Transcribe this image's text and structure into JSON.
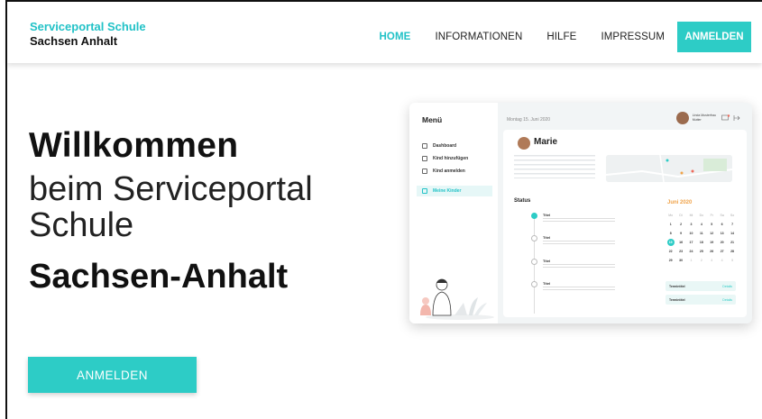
{
  "header": {
    "brand_top": "Serviceportal Schule",
    "brand_bottom": "Sachsen Anhalt",
    "nav": [
      "HOME",
      "INFORMATIONEN",
      "HILFE",
      "IMPRESSUM"
    ],
    "login": "ANMELDEN"
  },
  "hero": {
    "line1": "Willkommen",
    "line2": "beim Serviceportal",
    "line3": "Schule",
    "line4": "Sachsen-Anhalt",
    "button": "ANMELDEN"
  },
  "mockup": {
    "menu_title": "Menü",
    "menu_items": [
      "Dashboard",
      "Kind hinzufügen",
      "Kind anmelden",
      "Meine Kinder"
    ],
    "date": "Montag 15. Juni 2020",
    "user": "Linda Musterfrau",
    "user_role": "Mutter",
    "child_name": "Marie",
    "status_title": "Status",
    "timeline_title": "Titel",
    "calendar_title": "Juni 2020",
    "weekdays": [
      "Mo",
      "Di",
      "Mi",
      "Do",
      "Fr",
      "Sa",
      "So"
    ],
    "event_label": "Termintitel",
    "event_action": "Details",
    "accent": "#2dccc6"
  }
}
